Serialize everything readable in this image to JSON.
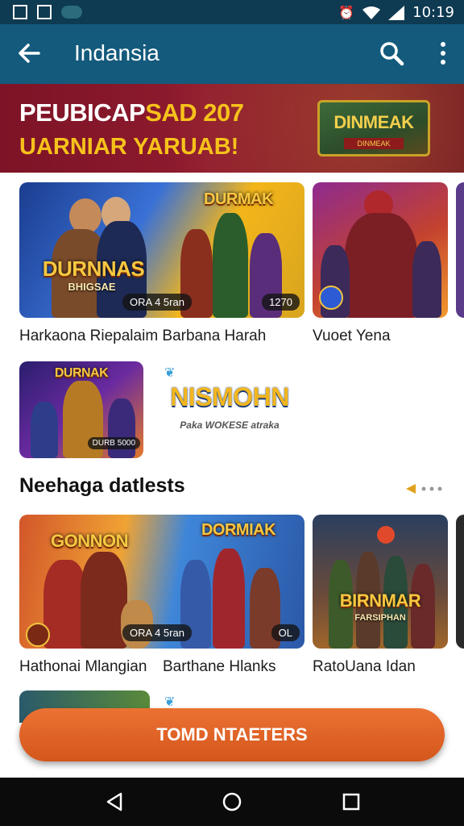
{
  "status_bar": {
    "time": "10:19",
    "icons": [
      "notification-icon",
      "image-icon",
      "cast-pill-icon",
      "alarm-icon",
      "wifi-icon",
      "signal-icon"
    ]
  },
  "app_bar": {
    "title": "Indansia",
    "back_icon": "back-arrow-icon",
    "search_icon": "search-icon",
    "more_icon": "more-vert-icon"
  },
  "banner": {
    "line1_white": "PEUBICAP",
    "line1_yellow": "SAD 207",
    "line2": "UARNIAR YARUAB!",
    "badge_title": "DINMEAK",
    "badge_sub": "DINMEAK"
  },
  "row1": {
    "tiles": [
      {
        "title": "DURNNAS",
        "sub": "BHIGSAE",
        "pill": "ORA 4 5ran",
        "caption": "Harkaona Riepalaim Barbana Harah"
      },
      {
        "title": "DURMAK",
        "pill": "1270"
      },
      {
        "title": "",
        "caption": "Vuoet Yena"
      }
    ]
  },
  "row2": {
    "tiles": [
      {
        "title": "DURNAK",
        "pill": "DURB 5000"
      },
      {
        "title": "NISMOHN",
        "sub": "Paka WOKESE atraka"
      }
    ]
  },
  "section": {
    "title": "Neehaga datlests"
  },
  "row3": {
    "tiles": [
      {
        "title": "GONNON",
        "pill": "ORA 4 5ran",
        "caption": "Hathonai Mlangian"
      },
      {
        "title": "DORMIAK",
        "pill": "OL",
        "caption": "Barthane Hlanks"
      },
      {
        "title": "BIRNMAR",
        "sub": "FARSIPHAN",
        "caption": "RatoUana Idan"
      }
    ]
  },
  "cta": {
    "label": "TOMD NTAETERS"
  },
  "nav_bar": {
    "back": "nav-back-icon",
    "home": "nav-home-icon",
    "recents": "nav-recents-icon"
  },
  "colors": {
    "status_bar": "#0e3a52",
    "app_bar": "#145a7c",
    "banner": "#7d1326",
    "accent_yellow": "#f6c21b",
    "cta": "#e2652a",
    "nav_bar": "#0b0b0b"
  }
}
